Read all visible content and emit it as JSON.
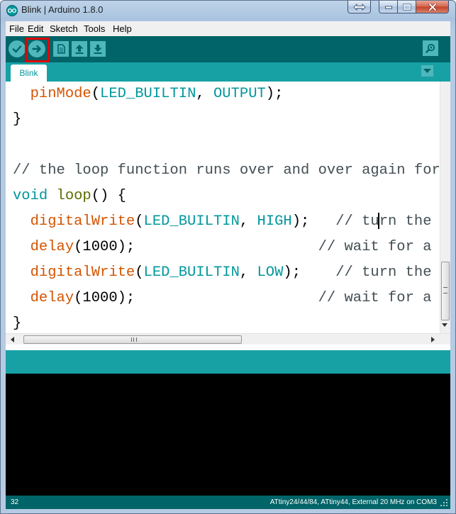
{
  "window": {
    "title": "Blink | Arduino 1.8.0"
  },
  "menubar": {
    "items": [
      "File",
      "Edit",
      "Sketch",
      "Tools",
      "Help"
    ]
  },
  "toolbar": {
    "verify_icon": "check-icon",
    "upload_icon": "right-arrow-icon",
    "new_icon": "document-icon",
    "open_icon": "up-arrow-icon",
    "save_icon": "down-arrow-icon",
    "serial_monitor_icon": "magnifier-icon",
    "highlighted_button": "upload",
    "highlight_color": "#e00000"
  },
  "tabs": [
    {
      "label": "Blink",
      "active": true
    }
  ],
  "editor": {
    "lines": [
      {
        "tokens": [
          {
            "text": "  ",
            "cls": ""
          },
          {
            "text": "pinMode",
            "cls": "kw-fn"
          },
          {
            "text": "(",
            "cls": ""
          },
          {
            "text": "LED_BUILTIN",
            "cls": "kw-const"
          },
          {
            "text": ", ",
            "cls": ""
          },
          {
            "text": "OUTPUT",
            "cls": "kw-const"
          },
          {
            "text": ");",
            "cls": ""
          }
        ]
      },
      {
        "tokens": [
          {
            "text": "}",
            "cls": ""
          }
        ]
      },
      {
        "tokens": []
      },
      {
        "tokens": [
          {
            "text": "// the loop function runs over and over again foreve",
            "cls": "comment"
          }
        ]
      },
      {
        "tokens": [
          {
            "text": "void",
            "cls": "kw-type"
          },
          {
            "text": " ",
            "cls": ""
          },
          {
            "text": "loop",
            "cls": "kw-loop"
          },
          {
            "text": "() {",
            "cls": ""
          }
        ]
      },
      {
        "tokens": [
          {
            "text": "  ",
            "cls": ""
          },
          {
            "text": "digitalWrite",
            "cls": "kw-fn"
          },
          {
            "text": "(",
            "cls": ""
          },
          {
            "text": "LED_BUILTIN",
            "cls": "kw-const"
          },
          {
            "text": ", ",
            "cls": ""
          },
          {
            "text": "HIGH",
            "cls": "kw-const"
          },
          {
            "text": ");   ",
            "cls": ""
          },
          {
            "text": "// turn the LED",
            "cls": "comment"
          }
        ]
      },
      {
        "tokens": [
          {
            "text": "  ",
            "cls": ""
          },
          {
            "text": "delay",
            "cls": "kw-fn"
          },
          {
            "text": "(1000);                     ",
            "cls": ""
          },
          {
            "text": "// wait for a s",
            "cls": "comment"
          }
        ]
      },
      {
        "tokens": [
          {
            "text": "  ",
            "cls": ""
          },
          {
            "text": "digitalWrite",
            "cls": "kw-fn"
          },
          {
            "text": "(",
            "cls": ""
          },
          {
            "text": "LED_BUILTIN",
            "cls": "kw-const"
          },
          {
            "text": ", ",
            "cls": ""
          },
          {
            "text": "LOW",
            "cls": "kw-const"
          },
          {
            "text": ");    ",
            "cls": ""
          },
          {
            "text": "// turn the LED",
            "cls": "comment"
          }
        ]
      },
      {
        "tokens": [
          {
            "text": "  ",
            "cls": ""
          },
          {
            "text": "delay",
            "cls": "kw-fn"
          },
          {
            "text": "(1000);                     ",
            "cls": ""
          },
          {
            "text": "// wait for a s",
            "cls": "comment"
          }
        ]
      },
      {
        "tokens": [
          {
            "text": "}",
            "cls": ""
          }
        ]
      }
    ]
  },
  "status": {
    "line_number": "32",
    "board_info": "ATtiny24/44/84, ATtiny44, External 20 MHz on COM3"
  },
  "colors": {
    "toolbar_dark": "#006468",
    "tab_bar": "#17a1a5",
    "button_fill": "#4db7bb",
    "console_bg": "#000000"
  }
}
